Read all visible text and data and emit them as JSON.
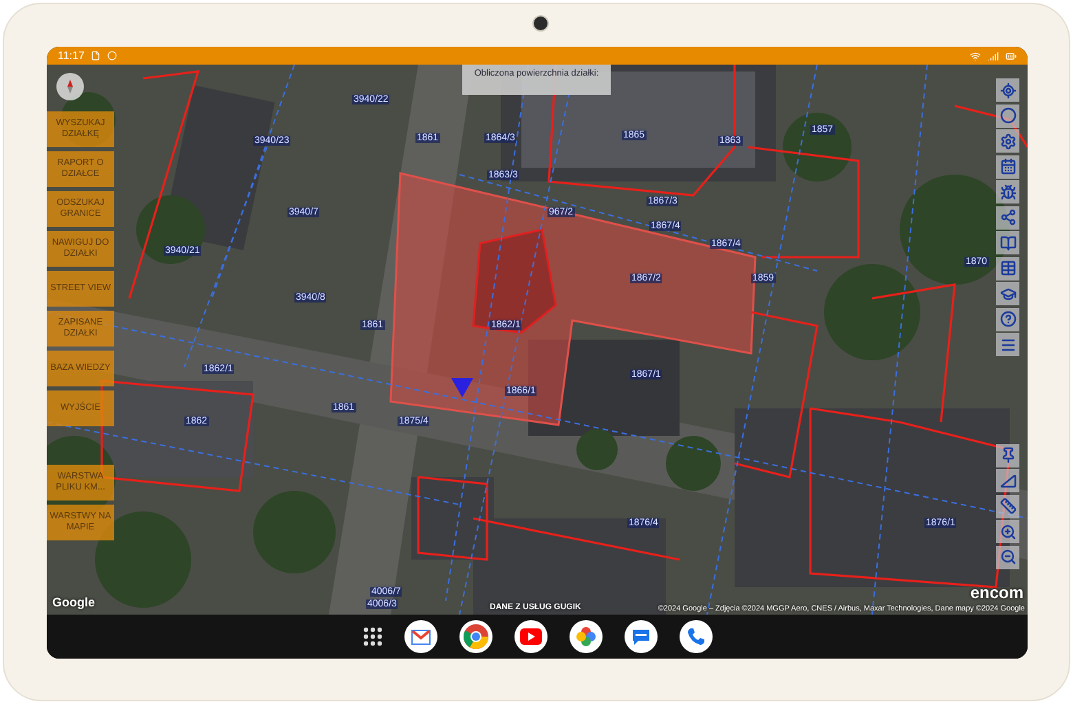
{
  "status_bar": {
    "time": "11:17"
  },
  "map": {
    "tooltip": "Obliczona powierzchnia działki:",
    "parcel_labels": [
      "3940/22",
      "1861",
      "1864/3",
      "1865",
      "1863",
      "1863/3",
      "1867/3",
      "967/2",
      "1867/4",
      "1867/4",
      "1867/2",
      "3940/7",
      "3940/8",
      "1862/1",
      "1861",
      "1867/1",
      "1866/1",
      "1861",
      "1875/4",
      "1859",
      "1862/1",
      "1862",
      "1876/4",
      "1876/1",
      "4006/7",
      "4006/3",
      "1857",
      "1870",
      "3940/21",
      "3940/23"
    ]
  },
  "menu_buttons": [
    {
      "label": "WYSZUKAJ DZIAŁKĘ"
    },
    {
      "label": "RAPORT O DZIAŁCE"
    },
    {
      "label": "ODSZUKAJ GRANICE"
    },
    {
      "label": "NAWIGUJ DO DZIAŁKI"
    },
    {
      "label": "STREET VIEW"
    },
    {
      "label": "ZAPISANE DZIAŁKI"
    },
    {
      "label": "BAZA WIEDZY"
    },
    {
      "label": "WYJŚCIE"
    }
  ],
  "layer_buttons": [
    {
      "label": "WARSTWA PLIKU KM..."
    },
    {
      "label": "WARSTWY NA MAPIE"
    }
  ],
  "attribution": {
    "provider": "Google",
    "source": "DANE Z USŁUG GUGIK",
    "copyright": "©2024 Google – Zdjęcia ©2024 MGGP Aero, CNES / Airbus, Maxar Technologies, Dane mapy ©2024 Google",
    "brand": "encom"
  }
}
